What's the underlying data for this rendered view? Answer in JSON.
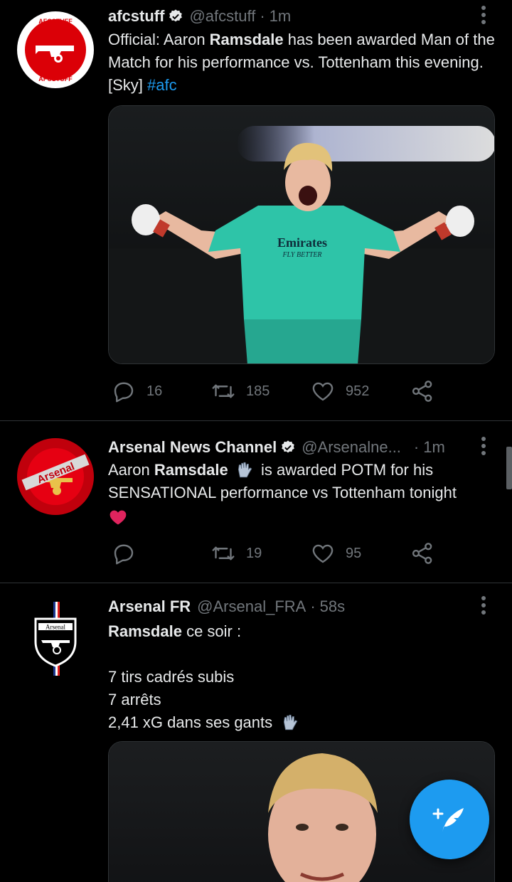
{
  "tweets": [
    {
      "name": "afcstuff",
      "handle": "@afcstuff",
      "sep": "·",
      "time": "1m",
      "text_prefix": "Official: Aaron ",
      "text_bold": "Ramsdale",
      "text_suffix": " has been awarded Man of the Match for his performance vs. Tottenham this evening. [Sky] ",
      "hashtag": "#afc",
      "avatar_text_top": "AFCSTUFF",
      "avatar_text_bottom": "AFCSTUFF",
      "image_text_1": "Emirates",
      "image_text_2": "FLY BETTER",
      "replies": "16",
      "retweets": "185",
      "likes": "952"
    },
    {
      "name": "Arsenal News Channel",
      "handle": "@Arsenalne...",
      "sep": "·",
      "time": "1m",
      "text_prefix": "Aaron ",
      "text_bold": "Ramsdale",
      "text_suffix": " is awarded POTM for his SENSATIONAL performance vs Tottenham tonight",
      "avatar_text": "Arsenal",
      "replies": "",
      "retweets": "19",
      "likes": "95"
    },
    {
      "name": "Arsenal FR",
      "handle": "@Arsenal_FRA",
      "sep": "·",
      "time": "58s",
      "text_bold": "Ramsdale",
      "text_after_bold": " ce soir :",
      "line1": "7 tirs cadrés subis",
      "line2": "7 arrêts",
      "line3": "2,41 xG dans ses gants",
      "avatar_text": "Arsenal"
    }
  ],
  "colors": {
    "accent": "#1d9bf0",
    "muted": "#71767b",
    "arsenal_red": "#db0007"
  },
  "icons": {
    "reply": "speech-bubble-icon",
    "retweet": "retweet-icon",
    "like": "heart-icon",
    "share": "share-icon",
    "compose": "feather-plus-icon"
  }
}
